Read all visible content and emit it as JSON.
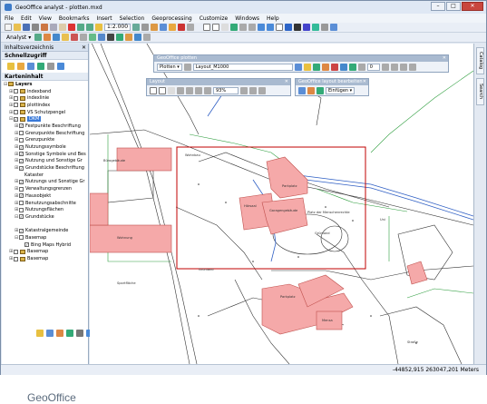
{
  "app": {
    "title": "GeoOffice analyst - plotten.mxd",
    "icon": "app-icon"
  },
  "window_controls": {
    "minimize": "–",
    "maximize": "□",
    "close": "✕"
  },
  "menu": [
    "File",
    "Edit",
    "View",
    "Bookmarks",
    "Insert",
    "Selection",
    "Geoprocessing",
    "Customize",
    "Windows",
    "Help"
  ],
  "toolbar1": {
    "scale": "1:2.000"
  },
  "toolbar2": {
    "analyst_label": "Analyst ▾"
  },
  "toc": {
    "title": "Inhaltsverzeichnis",
    "schnellzugriff": "Schnellzugriff",
    "karteninhalt": "Karteninhalt",
    "layers_root": "Layers",
    "items": [
      {
        "label": "indexband",
        "level": 1,
        "checked": false,
        "expanded": false,
        "group": true
      },
      {
        "label": "indexlinie",
        "level": 1,
        "checked": false,
        "expanded": false,
        "group": true
      },
      {
        "label": "plottindex",
        "level": 1,
        "checked": false,
        "expanded": false,
        "group": true
      },
      {
        "label": "VS Schutzpengel",
        "level": 1,
        "checked": false,
        "expanded": false,
        "group": true
      },
      {
        "label": "DKM",
        "level": 1,
        "checked": true,
        "expanded": true,
        "group": true,
        "selected": true
      },
      {
        "label": "Festpunkte Beschriftung",
        "level": 2,
        "checked": true,
        "expanded": false
      },
      {
        "label": "Grenzpunkte Beschriftung",
        "level": 2,
        "checked": false,
        "expanded": false
      },
      {
        "label": "Grenzpunkte",
        "level": 2,
        "checked": false,
        "expanded": false
      },
      {
        "label": "Nutzungssymbole",
        "level": 2,
        "checked": true,
        "expanded": false
      },
      {
        "label": "Sonstige Symbole und Bes",
        "level": 2,
        "checked": true,
        "expanded": false
      },
      {
        "label": "Nutzung und Sonstige Gr",
        "level": 2,
        "checked": true,
        "expanded": false
      },
      {
        "label": "Grundstücke Beschriftung",
        "level": 2,
        "checked": true,
        "expanded": false
      },
      {
        "label": "Kataster",
        "level": 3,
        "checked": null,
        "expanded": false
      },
      {
        "label": "Nutzungs und Sonstige Gr",
        "level": 2,
        "checked": true,
        "expanded": false
      },
      {
        "label": "Verwaltungsgrenzen",
        "level": 2,
        "checked": false,
        "expanded": false
      },
      {
        "label": "Hausobjekt",
        "level": 2,
        "checked": true,
        "expanded": false
      },
      {
        "label": "Benutzungsabschnitte",
        "level": 2,
        "checked": false,
        "expanded": false
      },
      {
        "label": "Nutzungsflächen",
        "level": 2,
        "checked": false,
        "expanded": false
      },
      {
        "label": "Grundstücke",
        "level": 2,
        "checked": true,
        "expanded": true
      },
      {
        "label": "",
        "level": 3,
        "checked": null,
        "expanded": false
      },
      {
        "label": "Katastralgemeinde",
        "level": 2,
        "checked": true,
        "expanded": false
      },
      {
        "label": "Basemap",
        "level": 2,
        "checked": false,
        "expanded": true
      },
      {
        "label": "Bing Maps Hybrid",
        "level": 3,
        "checked": true,
        "expanded": false
      },
      {
        "label": "Basemap",
        "level": 1,
        "checked": false,
        "expanded": false,
        "group": true
      },
      {
        "label": "Basemap",
        "level": 1,
        "checked": false,
        "expanded": false,
        "group": true
      }
    ]
  },
  "logo": "GeoOffice",
  "plotten_window": {
    "title": "GeoOffice plotten",
    "plotten_label": "Plotten ▾",
    "layout_value": "Layout_M1000",
    "value_field": "0"
  },
  "layout_window": {
    "title": "Layout",
    "zoom": "93%"
  },
  "bearbeiten_window": {
    "title": "GeoOffice layout bearbeiten",
    "einfuegen_label": "Einfügen ▾"
  },
  "right_tabs": [
    "Catalog",
    "Search"
  ],
  "map_labels": [
    "Wohnbau",
    "Bürogebäude",
    "Hörsaal",
    "Parkplatz",
    "Garagengebäude",
    "Platz der Menschenrechte",
    "Grünland",
    "Wohnung",
    "Uni",
    "Grünland",
    "Sportfläche",
    "Parkplatz",
    "Straße",
    "Mensa"
  ],
  "status": {
    "coordinates": "-44852,915  263047,201 Meters"
  },
  "colors": {
    "building_fill": "#f5a9a9",
    "building_stroke": "#c0504d",
    "boundary_green": "#2f9e3f",
    "road_blue": "#2f5fc4",
    "plot_frame": "#c00000"
  }
}
